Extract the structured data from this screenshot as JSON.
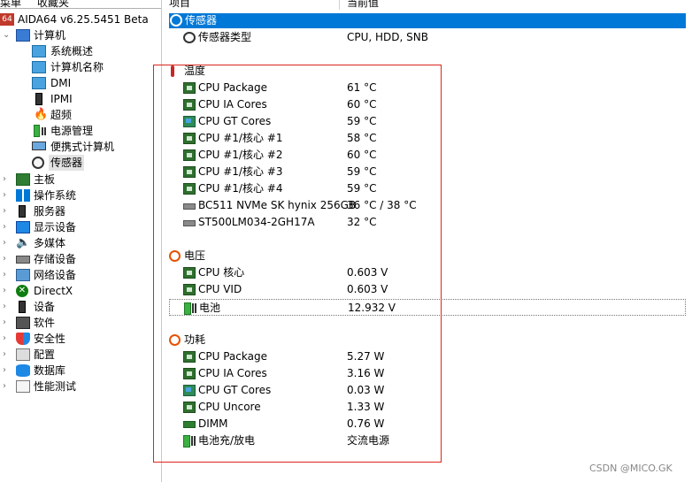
{
  "menu_tabs": [
    {
      "label": "菜单",
      "active": true
    },
    {
      "label": "收藏夹",
      "active": false
    }
  ],
  "columns": {
    "item": "项目",
    "value": "当前值"
  },
  "tree": {
    "root": {
      "label": "AIDA64 v6.25.5451 Beta",
      "icon": "aida64-logo-icon"
    },
    "computer": {
      "label": "计算机",
      "icon": "monitor-icon",
      "children": [
        {
          "label": "系统概述",
          "icon": "monitor-icon"
        },
        {
          "label": "计算机名称",
          "icon": "monitor-icon"
        },
        {
          "label": "DMI",
          "icon": "monitor-icon"
        },
        {
          "label": "IPMI",
          "icon": "tower-icon"
        },
        {
          "label": "超频",
          "icon": "flame-icon"
        },
        {
          "label": "电源管理",
          "icon": "battery-icon"
        },
        {
          "label": "便携式计算机",
          "icon": "laptop-icon"
        },
        {
          "label": "传感器",
          "icon": "gauge-icon",
          "selected": true
        }
      ]
    },
    "categories": [
      {
        "label": "主板",
        "icon": "motherboard-icon"
      },
      {
        "label": "操作系统",
        "icon": "windows-icon"
      },
      {
        "label": "服务器",
        "icon": "server-icon"
      },
      {
        "label": "显示设备",
        "icon": "display-icon"
      },
      {
        "label": "多媒体",
        "icon": "speaker-icon"
      },
      {
        "label": "存储设备",
        "icon": "storage-icon"
      },
      {
        "label": "网络设备",
        "icon": "network-icon"
      },
      {
        "label": "DirectX",
        "icon": "xbox-icon"
      },
      {
        "label": "设备",
        "icon": "device-icon"
      },
      {
        "label": "软件",
        "icon": "software-icon"
      },
      {
        "label": "安全性",
        "icon": "shield-icon"
      },
      {
        "label": "配置",
        "icon": "config-icon"
      },
      {
        "label": "数据库",
        "icon": "database-icon"
      },
      {
        "label": "性能测试",
        "icon": "benchmark-icon"
      }
    ]
  },
  "detail": {
    "selected_header": "传感器",
    "sensor_type": {
      "name": "传感器类型",
      "value": "CPU, HDD, SNB"
    },
    "temperature": {
      "title": "温度",
      "items": [
        {
          "name": "CPU Package",
          "value": "61 °C"
        },
        {
          "name": "CPU IA Cores",
          "value": "60 °C"
        },
        {
          "name": "CPU GT Cores",
          "value": "59 °C"
        },
        {
          "name": "CPU #1/核心 #1",
          "value": "58 °C"
        },
        {
          "name": "CPU #1/核心 #2",
          "value": "60 °C"
        },
        {
          "name": "CPU #1/核心 #3",
          "value": "59 °C"
        },
        {
          "name": "CPU #1/核心 #4",
          "value": "59 °C"
        },
        {
          "name": "BC511 NVMe SK hynix 256GB",
          "value": "36 °C / 38 °C"
        },
        {
          "name": "ST500LM034-2GH17A",
          "value": "32 °C"
        }
      ]
    },
    "voltage": {
      "title": "电压",
      "items": [
        {
          "name": "CPU 核心",
          "value": "0.603 V"
        },
        {
          "name": "CPU VID",
          "value": "0.603 V"
        },
        {
          "name": "电池",
          "value": "12.932 V"
        }
      ]
    },
    "power": {
      "title": "功耗",
      "items": [
        {
          "name": "CPU Package",
          "value": "5.27 W"
        },
        {
          "name": "CPU IA Cores",
          "value": "3.16 W"
        },
        {
          "name": "CPU GT Cores",
          "value": "0.03 W"
        },
        {
          "name": "CPU Uncore",
          "value": "1.33 W"
        },
        {
          "name": "DIMM",
          "value": "0.76 W"
        },
        {
          "name": "电池充/放电",
          "value": "交流电源"
        }
      ]
    }
  },
  "watermark": "CSDN @MICO.GK",
  "colors": {
    "selection": "#0078d7",
    "highlight_box": "#d9261c"
  }
}
